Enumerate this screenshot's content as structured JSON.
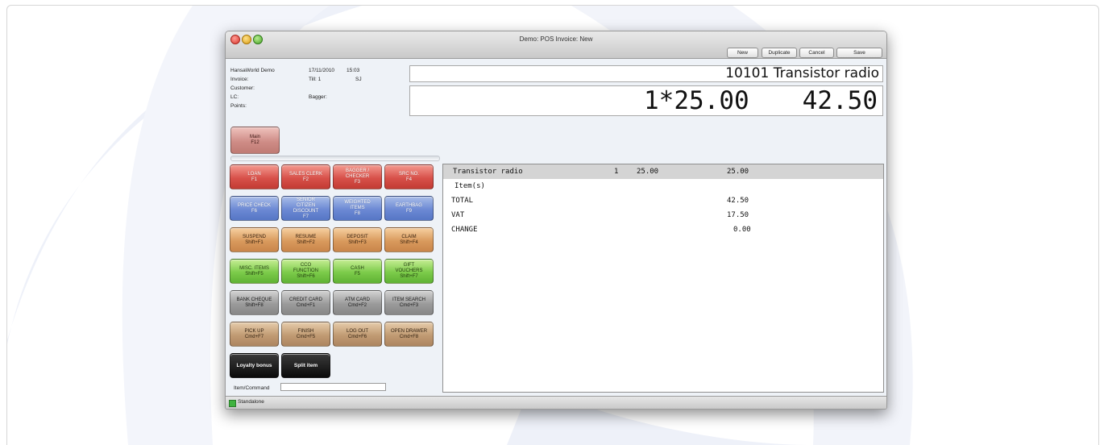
{
  "window": {
    "title": "Demo: POS Invoice: New",
    "toolbar": {
      "new": "New",
      "duplicate": "Duplicate",
      "cancel": "Cancel",
      "save": "Save"
    }
  },
  "info": {
    "company": "HansaWorld Demo",
    "date": "17/11/2010",
    "time": "15:03",
    "invoice_label": "Invoice:",
    "till": "Till: 1",
    "user": "SJ",
    "customer_label": "Customer:",
    "lc_label": "LC:",
    "bagger_label": "Bagger:",
    "points_label": "Points:"
  },
  "display": {
    "item_line": "10101 Transistor radio",
    "qty_price": "1*25.00",
    "amount": "42.50"
  },
  "main_button": {
    "label": "Main",
    "key": "F12"
  },
  "buttons": [
    {
      "label": "LOAN",
      "key": "F1"
    },
    {
      "label": "SALES CLERK",
      "key": "F2"
    },
    {
      "label": "BAGGER / CHECKER",
      "key": "F3"
    },
    {
      "label": "SRC NO.",
      "key": "F4"
    },
    {
      "label": "PRICE CHECK",
      "key": "F6"
    },
    {
      "label": "SENIOR CITIZEN DISCOUNT",
      "key": "F7"
    },
    {
      "label": "WEIGHTED ITEMS",
      "key": "F8"
    },
    {
      "label": "EARTHBAG",
      "key": "F9"
    },
    {
      "label": "SUSPEND",
      "key": "Shift+F1"
    },
    {
      "label": "RESUME",
      "key": "Shift+F2"
    },
    {
      "label": "DEPOSIT",
      "key": "Shift+F3"
    },
    {
      "label": "CLAIM",
      "key": "Shift+F4"
    },
    {
      "label": "MISC. ITEMS",
      "key": "Shift+F5"
    },
    {
      "label": "CCO FUNCTION",
      "key": "Shift+F6"
    },
    {
      "label": "CASH",
      "key": "F5"
    },
    {
      "label": "GIFT VOUCHERS",
      "key": "Shift+F7"
    },
    {
      "label": "BANK CHEQUE",
      "key": "Shift+F8"
    },
    {
      "label": "CREDIT CARD",
      "key": "Cmd+F1"
    },
    {
      "label": "ATM CARD",
      "key": "Cmd+F2"
    },
    {
      "label": "ITEM SEARCH",
      "key": "Cmd+F3"
    },
    {
      "label": "PICK UP",
      "key": "Cmd+F7"
    },
    {
      "label": "FINISH",
      "key": "Cmd+F5"
    },
    {
      "label": "LOG OUT",
      "key": "Cmd+F6"
    },
    {
      "label": "OPEN DRAWER",
      "key": "Cmd+F8"
    }
  ],
  "extra_buttons": {
    "loyalty": "Loyalty bonus",
    "split": "Split item"
  },
  "command": {
    "label": "Item/Command",
    "value": ""
  },
  "receipt": {
    "line": {
      "item": "Transistor radio",
      "qty": "1",
      "price": "25.00",
      "sum": "25.00"
    },
    "items_label": "Item(s)",
    "totals": [
      {
        "label": "TOTAL",
        "value": "42.50"
      },
      {
        "label": "VAT",
        "value": "17.50"
      },
      {
        "label": "CHANGE",
        "value": "0.00"
      }
    ]
  },
  "status": {
    "text": "Standalone"
  }
}
